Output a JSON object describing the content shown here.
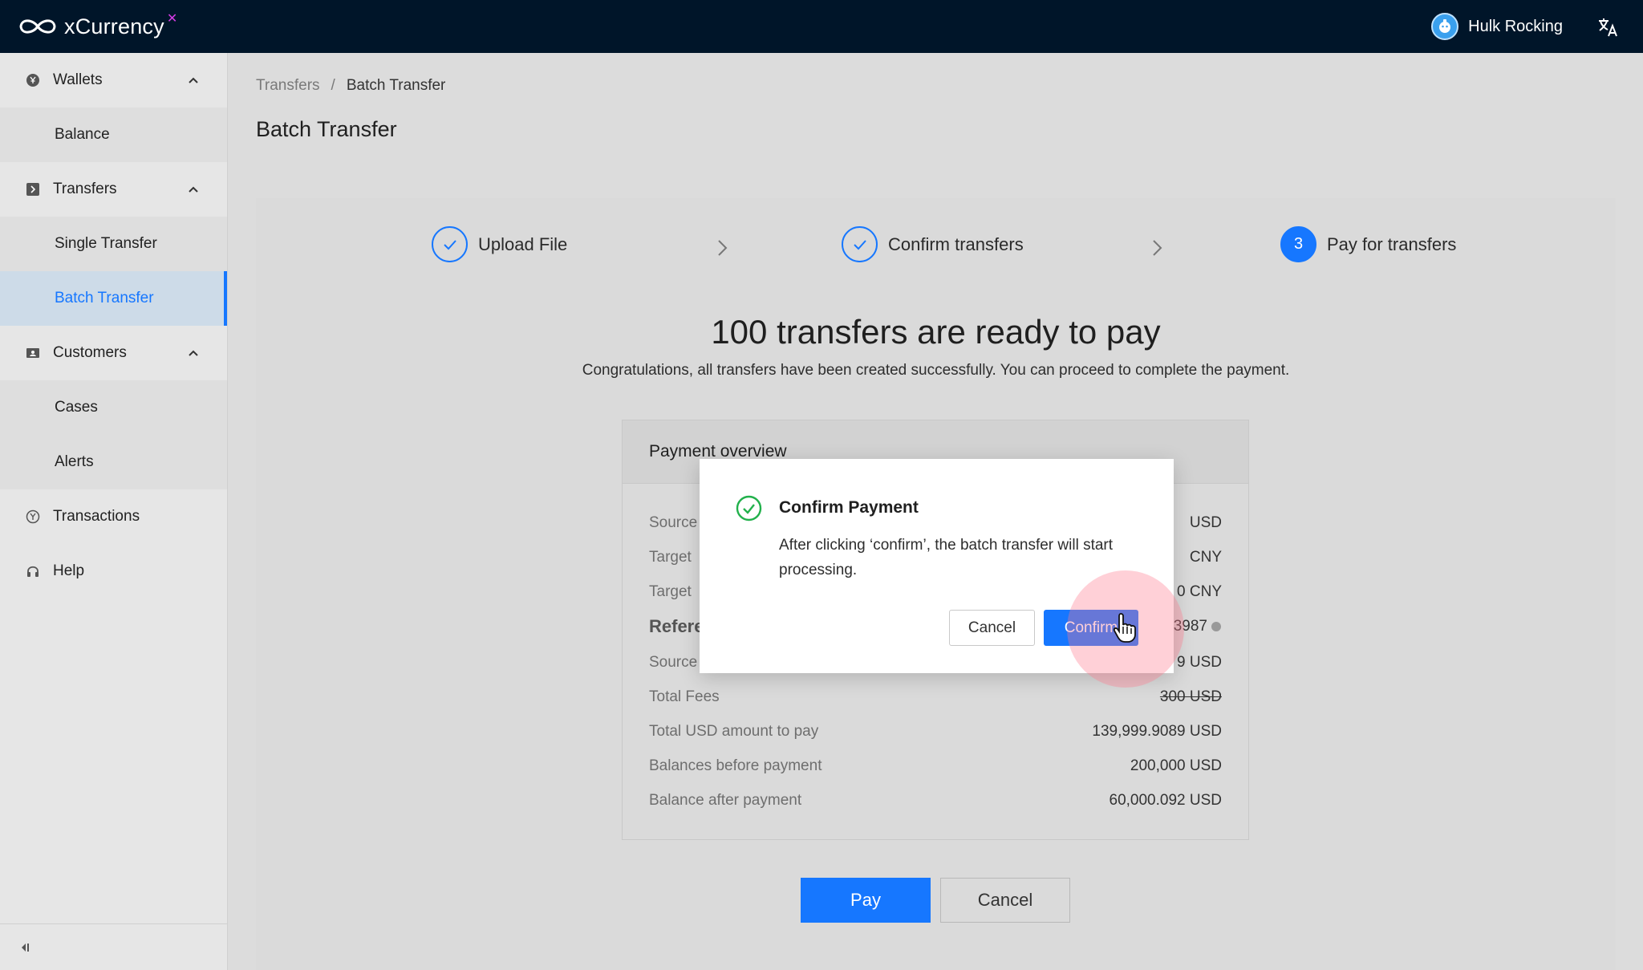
{
  "app": {
    "name": "xCurrency",
    "logo_mark": "infinity-logo",
    "user_name": "Hulk Rocking",
    "lang_icon": "translate-icon"
  },
  "sidebar": {
    "groups": [
      {
        "label": "Wallets",
        "icon": "wallet-icon",
        "children": [
          "Balance"
        ]
      },
      {
        "label": "Transfers",
        "icon": "transfer-icon",
        "children": [
          "Single Transfer",
          "Batch Transfer"
        ]
      },
      {
        "label": "Customers",
        "icon": "customers-icon",
        "children": [
          "Cases",
          "Alerts"
        ]
      }
    ],
    "items": [
      {
        "label": "Transactions",
        "icon": "transactions-icon"
      },
      {
        "label": "Help",
        "icon": "headset-icon"
      }
    ],
    "active": "Batch Transfer"
  },
  "breadcrumb": {
    "parent": "Transfers",
    "separator": "/",
    "current": "Batch Transfer"
  },
  "page_title": "Batch Transfer",
  "steps": [
    {
      "label": "Upload File",
      "state": "done"
    },
    {
      "label": "Confirm transfers",
      "state": "done"
    },
    {
      "label": "Pay for transfers",
      "state": "current",
      "number": "3"
    }
  ],
  "hero": {
    "title": "100 transfers are ready to pay",
    "subtitle": "Congratulations, all transfers have been created successfully. You can proceed to complete the payment."
  },
  "overview": {
    "title": "Payment overview",
    "rows": [
      {
        "label": "Source",
        "value": "USD"
      },
      {
        "label": "Target",
        "value": "CNY"
      },
      {
        "label": "Target",
        "value": "0 CNY"
      },
      {
        "label": "Refere",
        "value": "3987"
      },
      {
        "label": "Source",
        "value": "9 USD"
      },
      {
        "label": "Total Fees",
        "value": "300 USD"
      },
      {
        "label": "Total USD amount to pay",
        "value": "139,999.9089 USD"
      },
      {
        "label": "Balances before payment",
        "value": "200,000 USD"
      },
      {
        "label": "Balance after payment",
        "value": "60,000.092 USD"
      }
    ]
  },
  "buttons": {
    "pay": "Pay",
    "cancel": "Cancel"
  },
  "modal": {
    "title": "Confirm Payment",
    "text": "After clicking ‘confirm’, the batch transfer will start processing.",
    "cancel": "Cancel",
    "confirm": "Confirm"
  },
  "colors": {
    "primary": "#1677ff",
    "topbar": "#001529",
    "success": "#22b14c",
    "accent": "#d63ce6"
  }
}
